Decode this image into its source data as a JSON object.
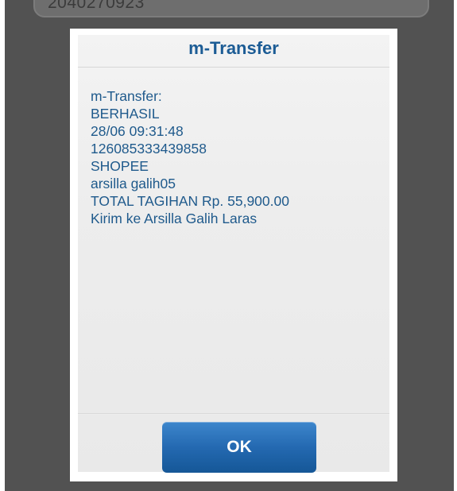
{
  "background": {
    "account_field_value": "2040270923"
  },
  "dialog": {
    "title": "m-Transfer",
    "message_lines": [
      "m-Transfer:",
      "BERHASIL",
      "28/06 09:31:48",
      "126085333439858",
      "SHOPEE",
      "arsilla galih05",
      "TOTAL TAGIHAN Rp. 55,900.00",
      "Kirim ke Arsilla Galih Laras"
    ],
    "ok_label": "OK"
  },
  "colors": {
    "title_text": "#1c5c95",
    "message_text": "#1f5a8c",
    "button_blue": "#2469b1",
    "overlay": "#525252"
  }
}
